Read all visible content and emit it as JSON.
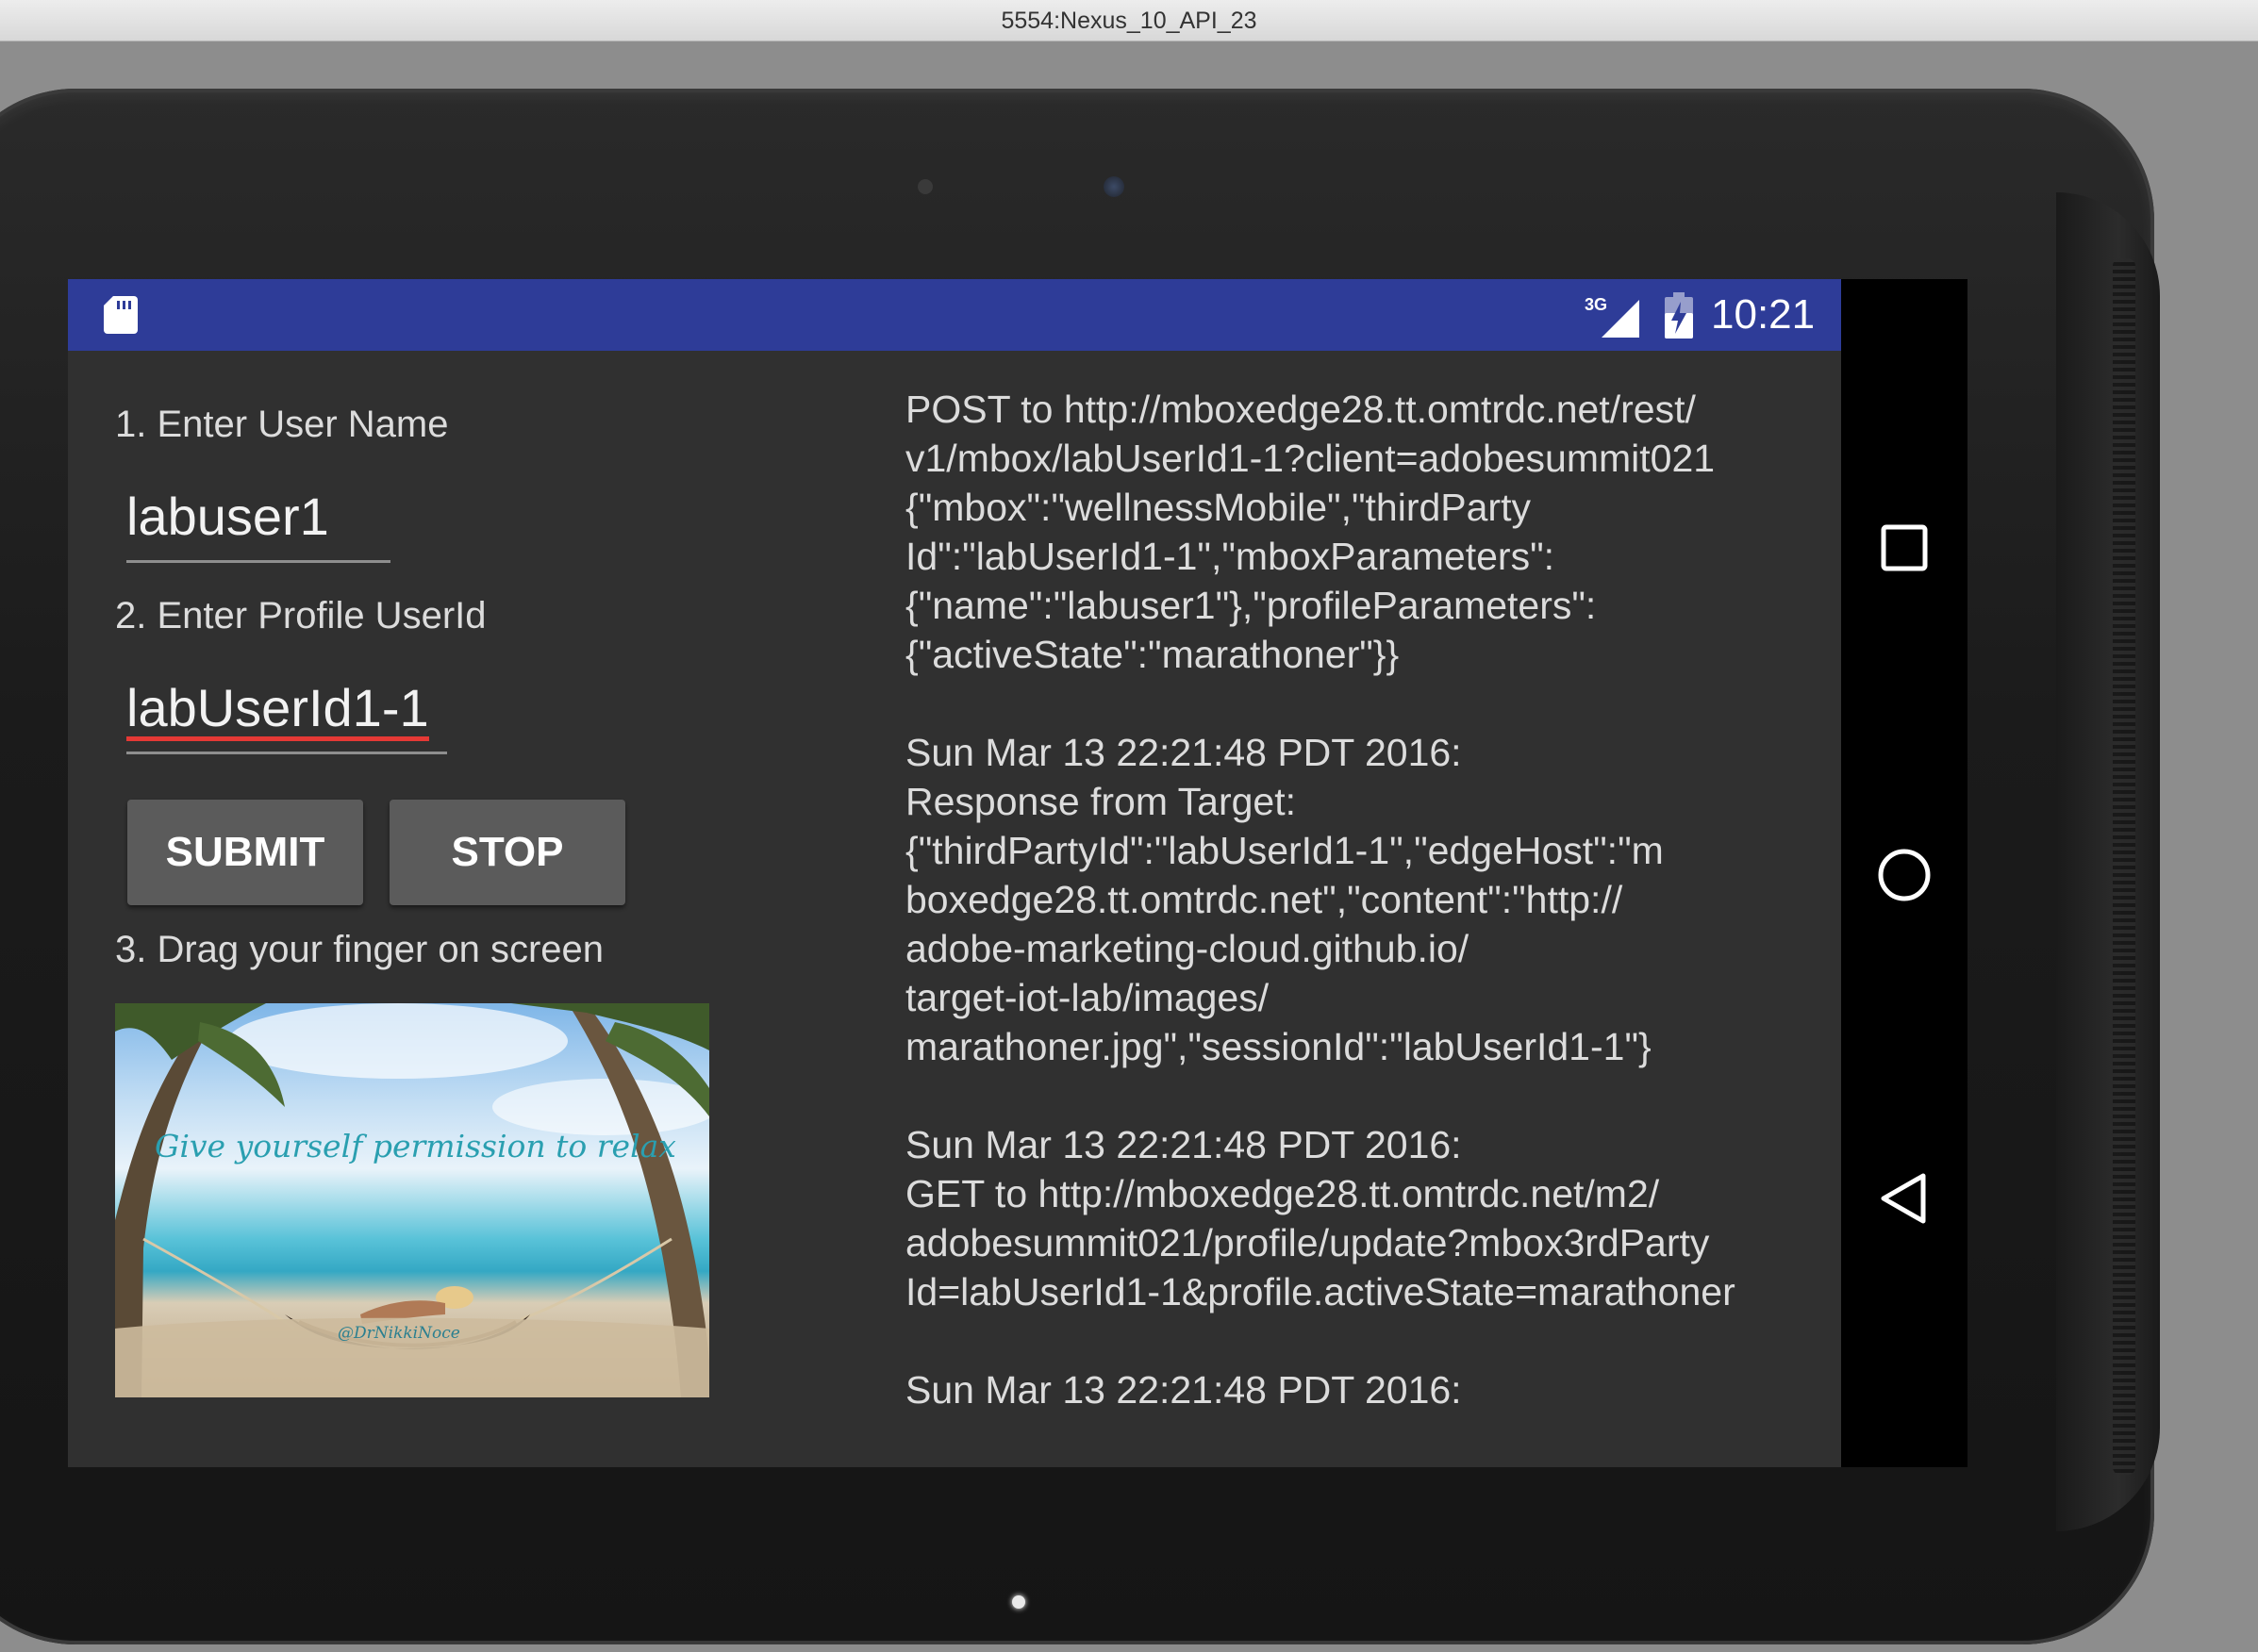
{
  "window": {
    "title": "5554:Nexus_10_API_23"
  },
  "status_bar": {
    "sd_icon": "sd-card-icon",
    "network_label": "3G",
    "signal_icon": "signal-icon",
    "battery_icon": "battery-charging-icon",
    "time": "10:21",
    "color": "#2e3c98"
  },
  "form": {
    "username_label": "1. Enter User Name",
    "username_value": "labuser1",
    "profile_label": "2. Enter Profile UserId",
    "profile_value": "labUserId1-1",
    "submit_label": "SUBMIT",
    "stop_label": "STOP",
    "drag_label": "3. Drag your finger on screen"
  },
  "image": {
    "caption": "Give yourself permission to relax",
    "credit": "@DrNikkiNoce"
  },
  "log": {
    "text": "POST to http://mboxedge28.tt.omtrdc.net/rest/\nv1/mbox/labUserId1-1?client=adobesummit021\n{\"mbox\":\"wellnessMobile\",\"thirdParty\nId\":\"labUserId1-1\",\"mboxParameters\":\n{\"name\":\"labuser1\"},\"profileParameters\":\n{\"activeState\":\"marathoner\"}}\n\nSun Mar 13 22:21:48 PDT 2016:\nResponse from Target:\n{\"thirdPartyId\":\"labUserId1-1\",\"edgeHost\":\"m\nboxedge28.tt.omtrdc.net\",\"content\":\"http://\nadobe-marketing-cloud.github.io/\ntarget-iot-lab/images/\nmarathoner.jpg\",\"sessionId\":\"labUserId1-1\"}\n\nSun Mar 13 22:21:48 PDT 2016:\nGET to http://mboxedge28.tt.omtrdc.net/m2/\nadobesummit021/profile/update?mbox3rdParty\nId=labUserId1-1&profile.activeState=marathoner\n\nSun Mar 13 22:21:48 PDT 2016:"
  },
  "nav_bar": {
    "recents_icon": "recents-square-icon",
    "home_icon": "home-circle-icon",
    "back_icon": "back-triangle-icon"
  }
}
